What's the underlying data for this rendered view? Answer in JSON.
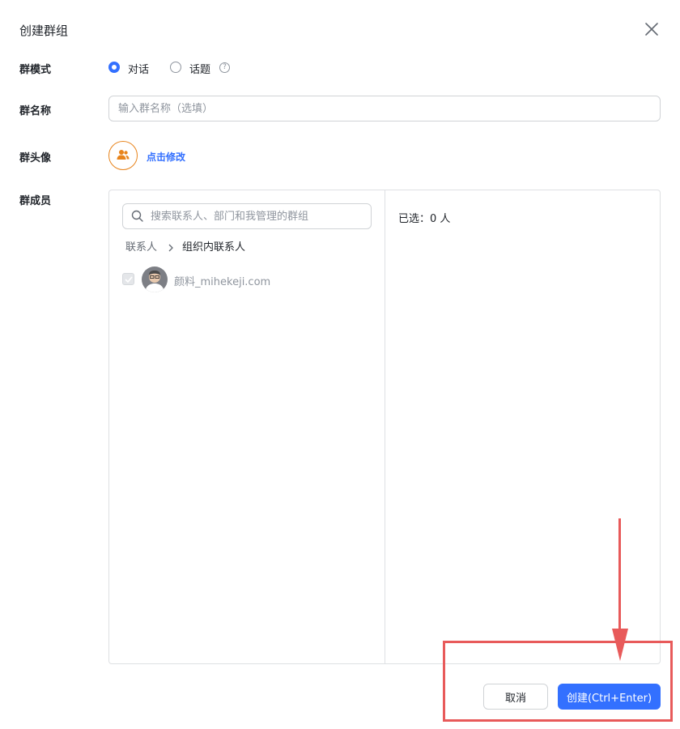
{
  "dialog": {
    "title": "创建群组"
  },
  "mode": {
    "label": "群模式",
    "options": [
      {
        "label": "对话",
        "selected": true
      },
      {
        "label": "话题",
        "selected": false
      }
    ],
    "help_icon": "question-circle-icon"
  },
  "group_name": {
    "label": "群名称",
    "placeholder": "输入群名称（选填）"
  },
  "avatar": {
    "label": "群头像",
    "edit_label": "点击修改",
    "icon": "people-icon",
    "accent_color": "#e8841c"
  },
  "members": {
    "label": "群成员",
    "search_placeholder": "搜索联系人、部门和我管理的群组",
    "breadcrumb": [
      "联系人",
      "组织内联系人"
    ],
    "contacts": [
      {
        "name": "颜料_mihekeji.com",
        "checked": true,
        "disabled": true
      }
    ],
    "selected_text": "已选：0 人"
  },
  "footer": {
    "cancel_label": "取消",
    "create_label": "创建(Ctrl+Enter)"
  },
  "colors": {
    "primary": "#3370ff",
    "annotation": "#e85a5a"
  }
}
